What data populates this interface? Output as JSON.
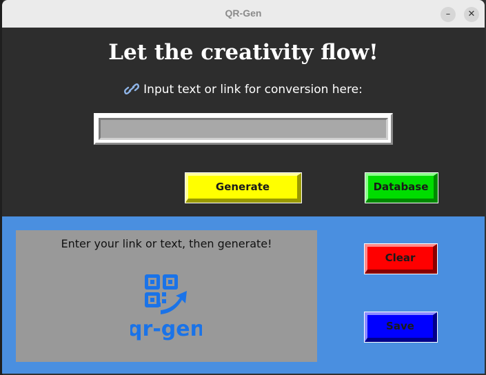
{
  "window": {
    "title": "QR-Gen",
    "minimize_label": "–",
    "close_label": "✕"
  },
  "header": {
    "headline": "Let the creativity flow!",
    "prompt_icon": "link-icon",
    "prompt_text": "Input text or link for conversion here:"
  },
  "input": {
    "value": "",
    "placeholder": ""
  },
  "buttons": {
    "generate": "Generate",
    "database": "Database",
    "clear": "Clear",
    "save": "Save"
  },
  "preview": {
    "message": "Enter your link or text, then generate!",
    "logo_text": "qr-gen"
  },
  "colors": {
    "top_bg": "#2d2d2d",
    "bottom_bg": "#4a8fe0",
    "preview_bg": "#999999",
    "generate": "#ffff00",
    "database": "#00dd00",
    "clear": "#ff0000",
    "save": "#0000ff",
    "logo": "#1a73e8"
  }
}
